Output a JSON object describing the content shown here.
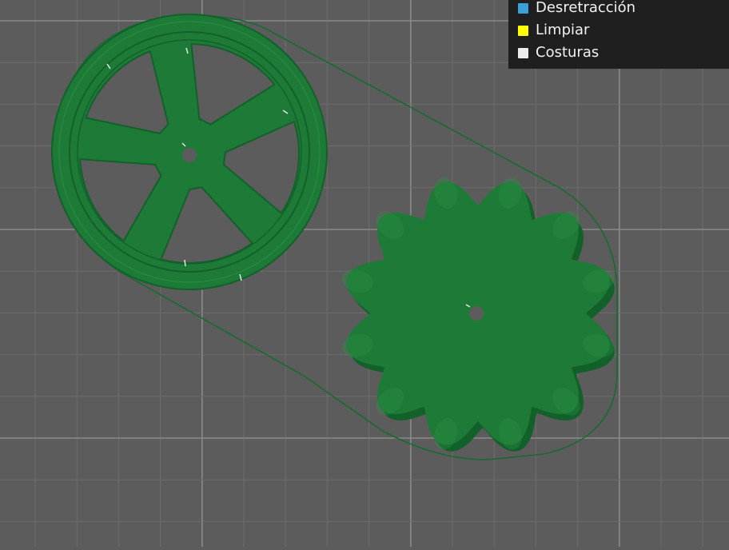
{
  "colors": {
    "background": "#5c5c5c",
    "grid_minor": "#6d6d6d",
    "grid_major": "#8a8a8a",
    "filament": "#1e7a37",
    "filament_dark": "#13612a",
    "filament_light": "#2a8f45",
    "skirt": "#176b2f",
    "legend_bg": "#1f1f1f"
  },
  "legend": {
    "items": [
      {
        "label": "Desretracción",
        "color": "#3aa0d8",
        "icon": "color-swatch-icon"
      },
      {
        "label": "Limpiar",
        "color": "#ffff00",
        "icon": "color-swatch-icon"
      },
      {
        "label": "Costuras",
        "color": "#ececec",
        "icon": "color-swatch-icon"
      }
    ]
  },
  "scene": {
    "objects": [
      "spoked-wheel",
      "gear"
    ]
  }
}
